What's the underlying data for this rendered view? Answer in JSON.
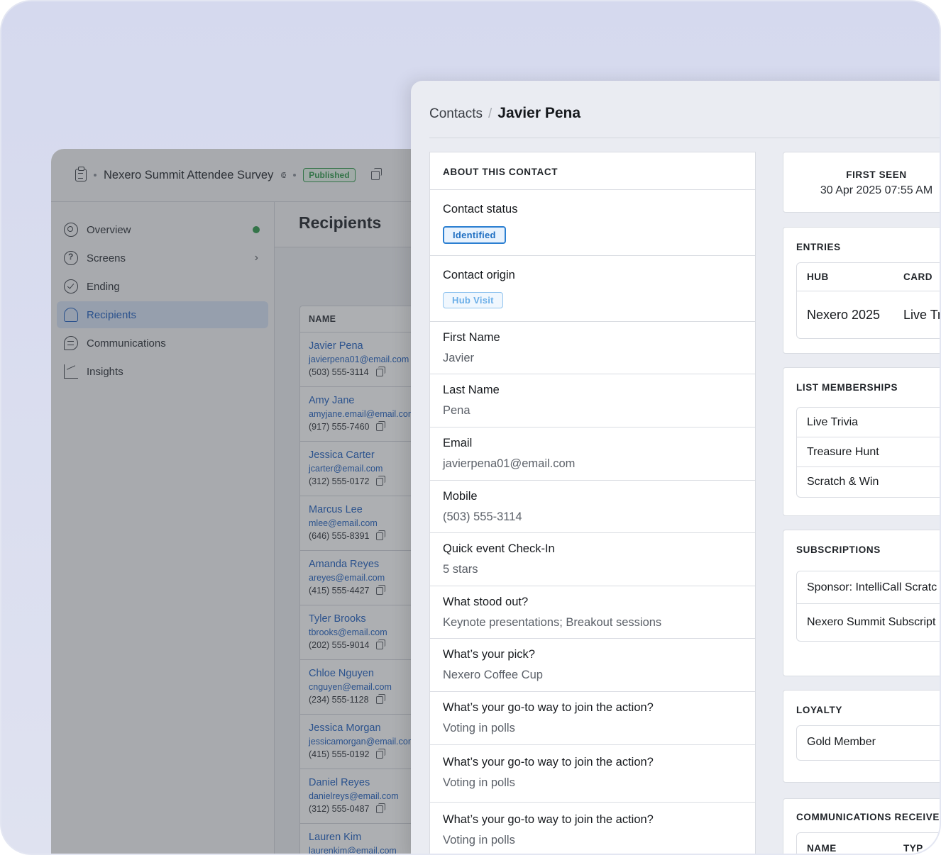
{
  "survey": {
    "title": "Nexero Summit Attendee Survey",
    "status": "Published"
  },
  "sidebar": {
    "items": [
      {
        "label": "Overview",
        "icon": "overview-icon"
      },
      {
        "label": "Screens",
        "icon": "question-icon"
      },
      {
        "label": "Ending",
        "icon": "check-circle-icon"
      },
      {
        "label": "Recipients",
        "icon": "users-icon"
      },
      {
        "label": "Communications",
        "icon": "chat-icon"
      },
      {
        "label": "Insights",
        "icon": "chart-icon"
      }
    ]
  },
  "recipients": {
    "title": "Recipients",
    "column_name": "NAME",
    "rows": [
      {
        "name": "Javier Pena",
        "email": "javierpena01@email.com",
        "phone": "(503) 555-3114"
      },
      {
        "name": "Amy Jane",
        "email": "amyjane.email@email.com",
        "phone": "(917) 555-7460"
      },
      {
        "name": "Jessica Carter",
        "email": "jcarter@email.com",
        "phone": "(312) 555-0172"
      },
      {
        "name": "Marcus Lee",
        "email": "mlee@email.com",
        "phone": "(646) 555-8391"
      },
      {
        "name": "Amanda Reyes",
        "email": "areyes@email.com",
        "phone": "(415) 555-4427"
      },
      {
        "name": "Tyler Brooks",
        "email": "tbrooks@email.com",
        "phone": "(202) 555-9014"
      },
      {
        "name": "Chloe Nguyen",
        "email": "cnguyen@email.com",
        "phone": "(234) 555-1128"
      },
      {
        "name": "Jessica Morgan",
        "email": "jessicamorgan@email.com",
        "phone": "(415) 555-0192"
      },
      {
        "name": "Daniel Reyes",
        "email": "danielreys@email.com",
        "phone": "(312) 555-0487"
      },
      {
        "name": "Lauren Kim",
        "email": "laurenkim@email.com",
        "phone": ""
      }
    ]
  },
  "contact": {
    "breadcrumb_parent": "Contacts",
    "breadcrumb_sep": "/",
    "name": "Javier Pena",
    "about_title": "ABOUT THIS CONTACT",
    "status_label": "Contact status",
    "status_value": "Identified",
    "origin_label": "Contact origin",
    "origin_value": "Hub Visit",
    "fields": [
      {
        "label": "First Name",
        "value": "Javier"
      },
      {
        "label": "Last Name",
        "value": "Pena"
      },
      {
        "label": "Email",
        "value": "javierpena01@email.com"
      },
      {
        "label": "Mobile",
        "value": "(503) 555-3114"
      },
      {
        "label": "Quick event Check-In",
        "value": "5 stars"
      },
      {
        "label": "What stood out?",
        "value": "Keynote presentations; Breakout sessions"
      },
      {
        "label": "What’s your pick?",
        "value": "Nexero Coffee Cup"
      },
      {
        "label": "What’s your go-to way to join the action?",
        "value": "Voting in polls"
      },
      {
        "label": "What’s your go-to way to join the action?",
        "value": "Voting in polls"
      },
      {
        "label": "What’s your go-to way to join the action?",
        "value": "Voting in polls"
      }
    ]
  },
  "first_seen": {
    "label": "FIRST SEEN",
    "value": "30 Apr 2025 07:55 AM"
  },
  "entries": {
    "title": "ENTRIES",
    "columns": [
      "HUB",
      "CARD"
    ],
    "rows": [
      [
        "Nexero 2025",
        "Live Tr"
      ]
    ]
  },
  "list_memberships": {
    "title": "LIST MEMBERSHIPS",
    "items": [
      "Live Trivia",
      "Treasure Hunt",
      "Scratch & Win"
    ]
  },
  "subscriptions": {
    "title": "SUBSCRIPTIONS",
    "items": [
      "Sponsor: IntelliCall Scratc",
      "Nexero Summit Subscript"
    ]
  },
  "loyalty": {
    "title": "LOYALTY",
    "value": "Gold Member"
  },
  "communications": {
    "title": "COMMUNICATIONS RECEIVED",
    "columns": [
      "NAME",
      "TYP"
    ]
  },
  "colors": {
    "accent": "#1f5fbf",
    "published": "#2f9a4a",
    "identified": "#1f6fc2"
  }
}
